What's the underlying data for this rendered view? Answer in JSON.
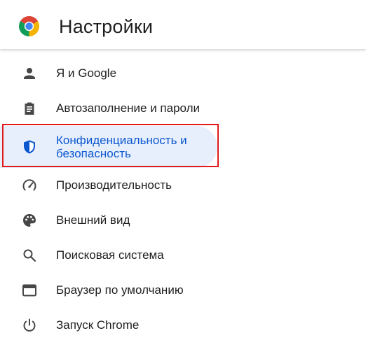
{
  "header": {
    "title": "Настройки",
    "logo_icon": "chrome-logo-icon"
  },
  "nav": {
    "items": [
      {
        "label": "Я и Google",
        "icon": "person-icon",
        "active": false
      },
      {
        "label": "Автозаполнение и пароли",
        "icon": "clipboard-icon",
        "active": false
      },
      {
        "label": "Конфиденциальность и безопасность",
        "icon": "shield-icon",
        "active": true
      },
      {
        "label": "Производительность",
        "icon": "speedometer-icon",
        "active": false
      },
      {
        "label": "Внешний вид",
        "icon": "palette-icon",
        "active": false
      },
      {
        "label": "Поисковая система",
        "icon": "search-icon",
        "active": false
      },
      {
        "label": "Браузер по умолчанию",
        "icon": "browser-window-icon",
        "active": false
      },
      {
        "label": "Запуск Chrome",
        "icon": "power-icon",
        "active": false
      }
    ]
  },
  "colors": {
    "active_text": "#0b57d0",
    "active_background": "#e8effc",
    "highlight_border": "#e11b1b",
    "icon": "#474747"
  }
}
